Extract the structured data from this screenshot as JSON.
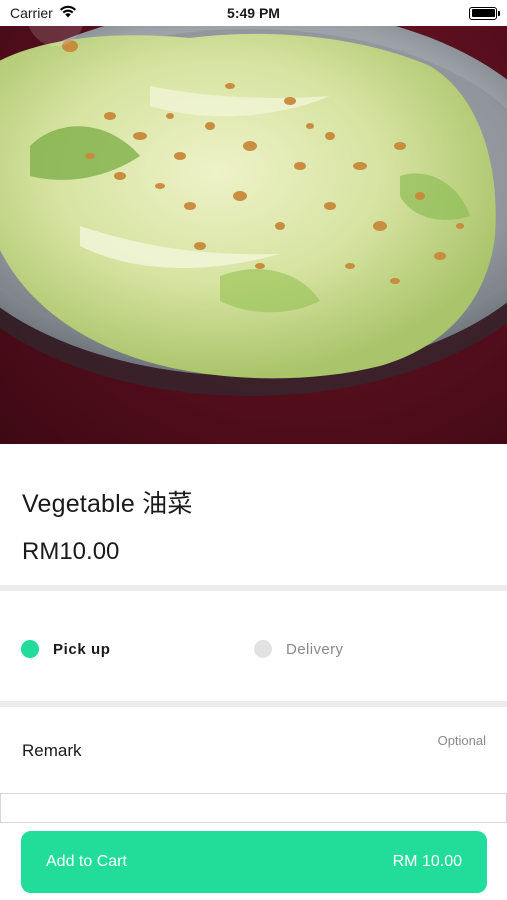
{
  "status_bar": {
    "carrier": "Carrier",
    "time": "5:49 PM"
  },
  "hero": {
    "image": "stir-fried cabbage with fried garlic on a metal plate"
  },
  "item": {
    "name": "Vegetable 油菜",
    "price": "RM10.00"
  },
  "delivery_options": [
    {
      "label": "Pick up",
      "selected": true
    },
    {
      "label": "Delivery",
      "selected": false
    }
  ],
  "remark": {
    "label": "Remark",
    "optional": "Optional",
    "value": "",
    "placeholder": ""
  },
  "cart_button": {
    "label": "Add to Cart",
    "total": "RM 10.00"
  },
  "colors": {
    "accent": "#22dd9a",
    "hero_background": "#5a0f1e",
    "divider": "#ececec"
  }
}
